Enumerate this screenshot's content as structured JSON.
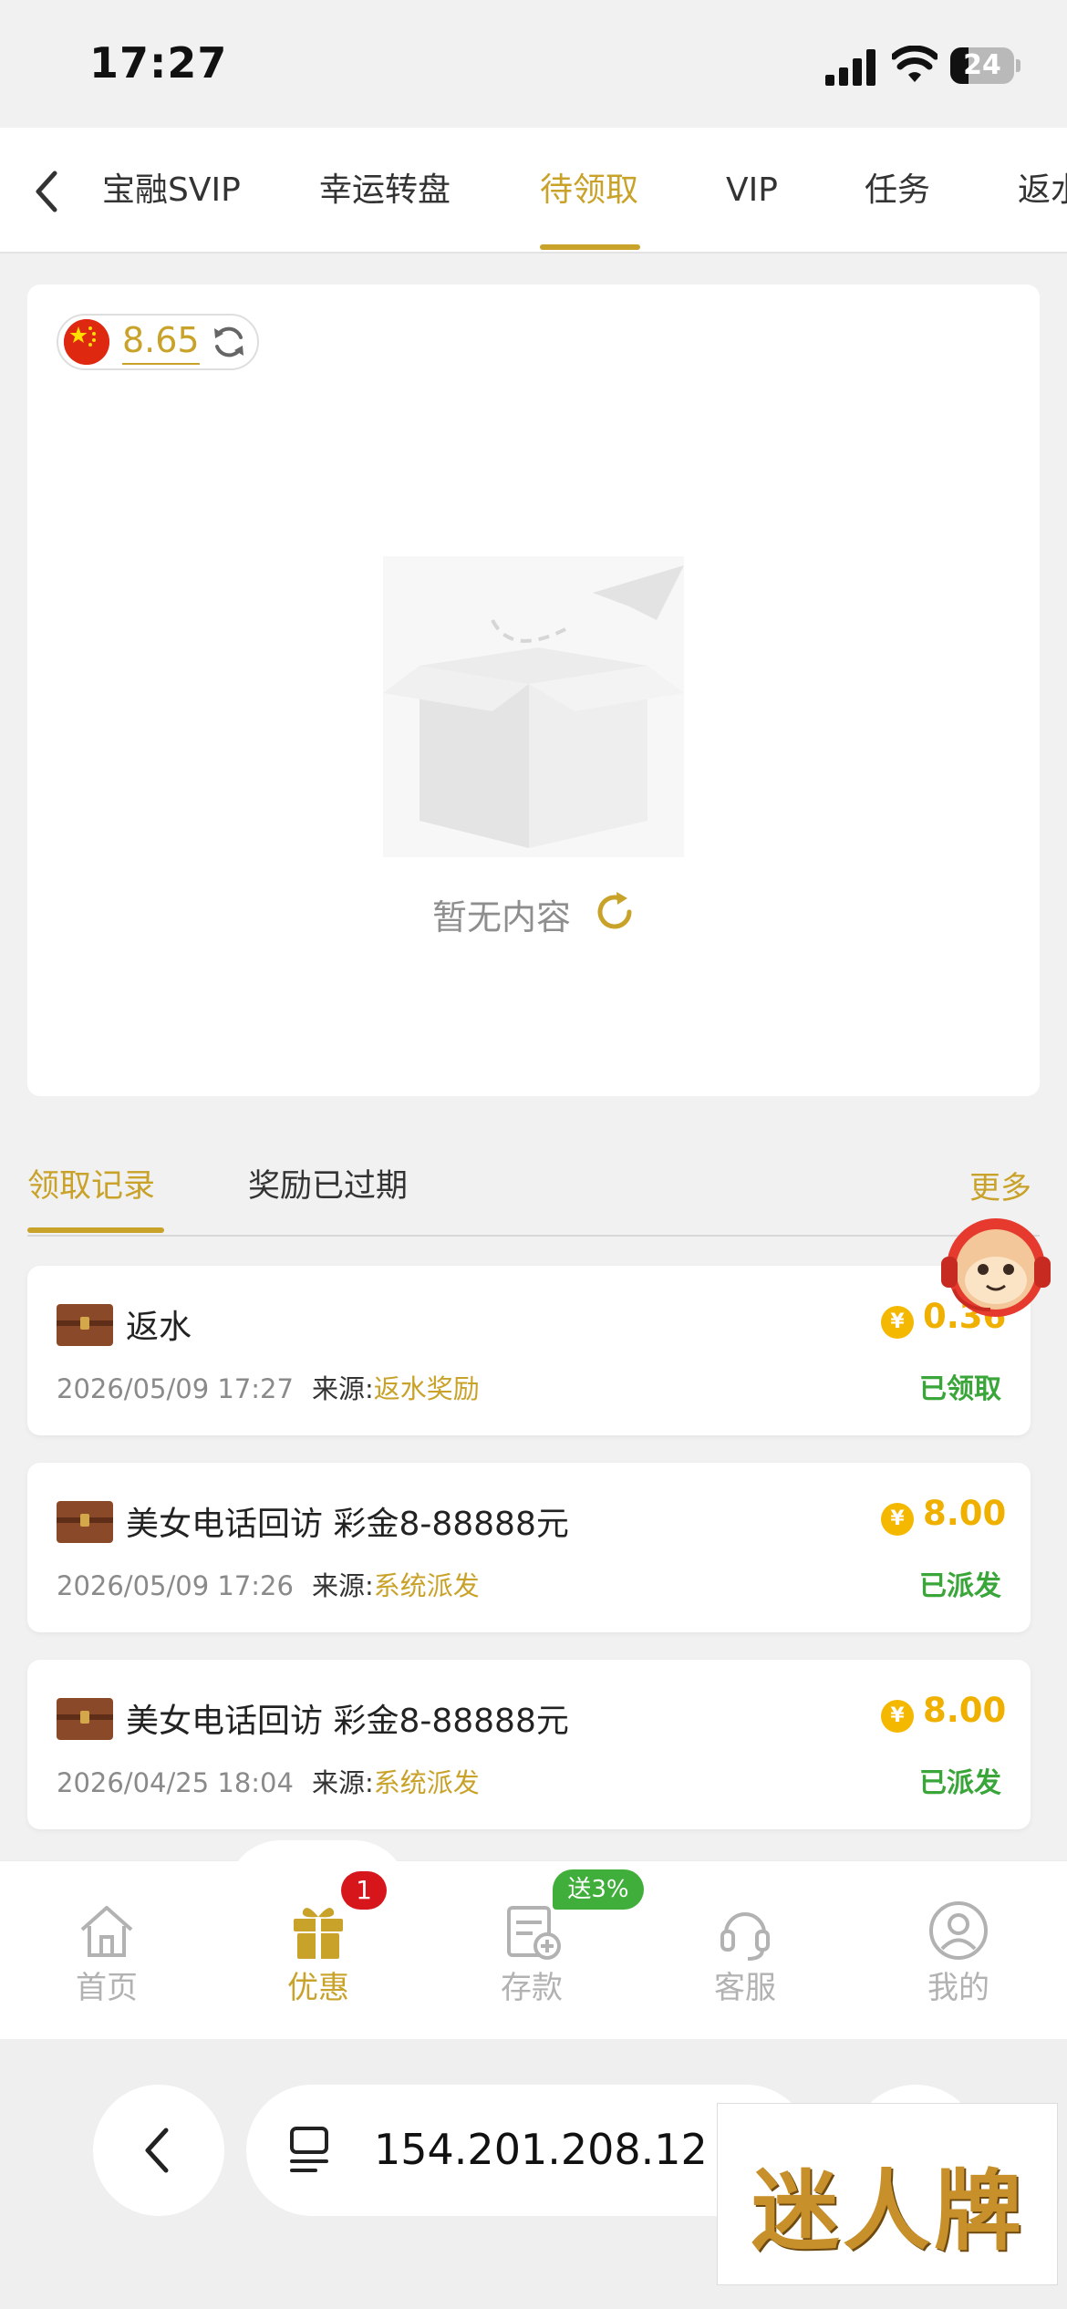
{
  "status_bar": {
    "time": "17:27",
    "battery": "24"
  },
  "tabs": [
    {
      "label": "宝融SVIP",
      "active": false
    },
    {
      "label": "幸运转盘",
      "active": false
    },
    {
      "label": "待领取",
      "active": true
    },
    {
      "label": "VIP",
      "active": false
    },
    {
      "label": "任务",
      "active": false
    },
    {
      "label": "返水",
      "active": false
    }
  ],
  "balance": {
    "value": "8.65",
    "flag": "cn-flag"
  },
  "empty_state": {
    "text": "暂无内容"
  },
  "record_tabs": {
    "claimed": "领取记录",
    "expired": "奖励已过期",
    "more": "更多"
  },
  "records": [
    {
      "title": "返水",
      "datetime": "2026/05/09 17:27",
      "source_label": "来源:",
      "source": "返水奖励",
      "amount": "0.36",
      "status": "已领取"
    },
    {
      "title": "美女电话回访 彩金8-88888元",
      "datetime": "2026/05/09 17:26",
      "source_label": "来源:",
      "source": "系统派发",
      "amount": "8.00",
      "status": "已派发"
    },
    {
      "title": "美女电话回访 彩金8-88888元",
      "datetime": "2026/04/25 18:04",
      "source_label": "来源:",
      "source": "系统派发",
      "amount": "8.00",
      "status": "已派发"
    }
  ],
  "coin_symbol": "¥",
  "bottom_nav": [
    {
      "label": "首页",
      "icon": "home-icon",
      "active": false
    },
    {
      "label": "优惠",
      "icon": "gift-icon",
      "active": true,
      "badge": "1"
    },
    {
      "label": "存款",
      "icon": "deposit-icon",
      "active": false,
      "badge": "送3%"
    },
    {
      "label": "客服",
      "icon": "headset-icon",
      "active": false
    },
    {
      "label": "我的",
      "icon": "user-icon",
      "active": false
    }
  ],
  "browser": {
    "url": "154.201.208.12"
  },
  "watermark": "迷人牌",
  "colors": {
    "gold": "#c9a22a",
    "coin": "#f0b000",
    "green": "#3aa63a",
    "badge_red": "#d6161a",
    "badge_green": "#3fae3a"
  }
}
